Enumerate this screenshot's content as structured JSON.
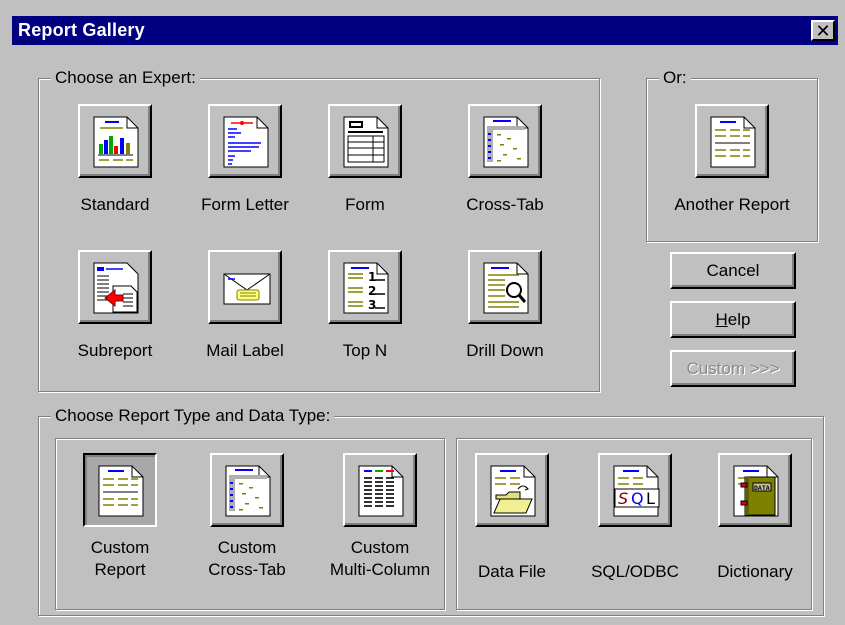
{
  "window": {
    "title": "Report Gallery",
    "close_label": "✕"
  },
  "experts": {
    "legend": "Choose an Expert:",
    "items": [
      {
        "label": "Standard",
        "icon": "standard-report-icon"
      },
      {
        "label": "Form Letter",
        "icon": "form-letter-icon"
      },
      {
        "label": "Form",
        "icon": "form-icon"
      },
      {
        "label": "Cross-Tab",
        "icon": "cross-tab-icon"
      },
      {
        "label": "Subreport",
        "icon": "subreport-icon"
      },
      {
        "label": "Mail Label",
        "icon": "mail-label-icon"
      },
      {
        "label": "Top N",
        "icon": "top-n-icon"
      },
      {
        "label": "Drill Down",
        "icon": "drill-down-icon"
      }
    ]
  },
  "or_group": {
    "legend": "Or:",
    "another_report": "Another Report"
  },
  "buttons": {
    "cancel": "Cancel",
    "help_prefix": "",
    "help_hot": "H",
    "help_rest": "elp",
    "custom": "Custom >>>"
  },
  "report_types": {
    "legend": "Choose Report Type and Data Type:",
    "items": [
      {
        "line1": "Custom",
        "line2": "Report",
        "icon": "custom-report-icon",
        "selected": true
      },
      {
        "line1": "Custom",
        "line2": "Cross-Tab",
        "icon": "custom-cross-tab-icon",
        "selected": false
      },
      {
        "line1": "Custom",
        "line2": "Multi-Column",
        "icon": "custom-multi-column-icon",
        "selected": false
      }
    ]
  },
  "data_types": {
    "items": [
      {
        "label": "Data File",
        "icon": "data-file-icon"
      },
      {
        "label": "SQL/ODBC",
        "icon": "sql-odbc-icon"
      },
      {
        "label": "Dictionary",
        "icon": "dictionary-icon"
      }
    ]
  },
  "colors": {
    "title_bar": "#000080",
    "face": "#c0c0c0",
    "doc_line_blue": "#0000ff",
    "doc_line_olive": "#808000"
  }
}
